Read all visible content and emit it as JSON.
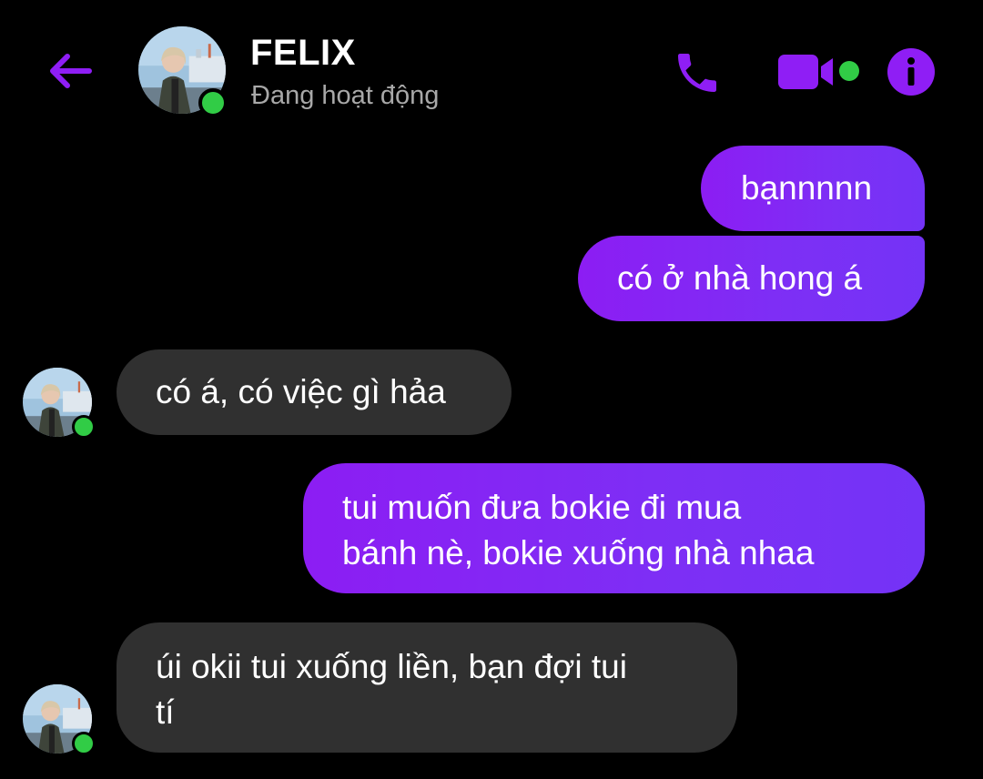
{
  "header": {
    "back_icon": "arrow-left-icon",
    "contact_name": "FELIX",
    "status": "Đang hoạt động",
    "actions": {
      "call_icon": "phone-icon",
      "video_icon": "video-camera-icon",
      "info_icon": "info-icon"
    }
  },
  "messages": [
    {
      "direction": "outgoing",
      "lines": [
        "bạnnnnn"
      ]
    },
    {
      "direction": "outgoing",
      "lines": [
        "có ở nhà hong á"
      ]
    },
    {
      "direction": "incoming",
      "lines": [
        "có á, có việc gì hảa"
      ]
    },
    {
      "direction": "outgoing",
      "lines": [
        "tui muốn đưa bokie đi mua",
        "bánh nè, bokie xuống nhà nhaa"
      ]
    },
    {
      "direction": "incoming",
      "lines": [
        "úi okii tui xuống liền, bạn đợi tui",
        "tí"
      ]
    }
  ],
  "colors": {
    "accent": "#8f1ef5",
    "outgoing_bubble": "#7d2ff5",
    "incoming_bubble": "#303030",
    "online": "#31cc46",
    "background": "#000000",
    "status_text": "#a8a8a8"
  }
}
